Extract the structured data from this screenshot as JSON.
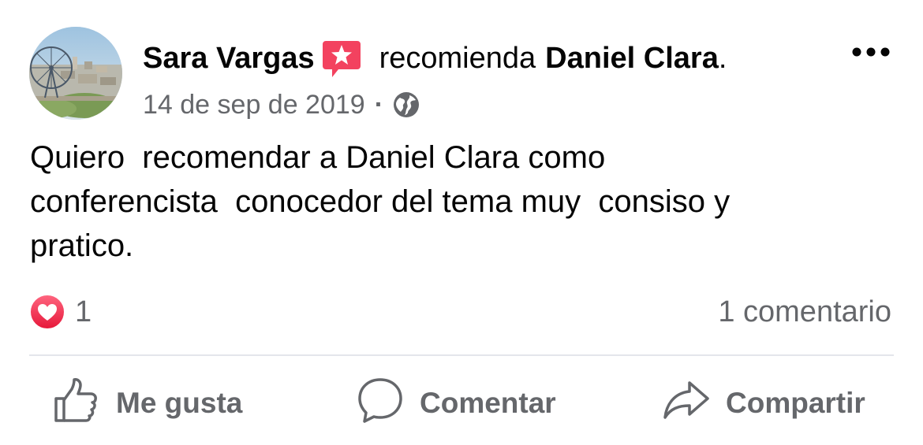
{
  "post": {
    "author": "Sara Vargas",
    "action_verb": "recomienda",
    "recommended": "Daniel Clara",
    "period": ".",
    "date": "14 de sep de 2019",
    "separator": "·",
    "privacy_icon": "globe-icon",
    "badge_icon": "recommendation-star-icon",
    "more_icon": "more-options-icon",
    "text": "Quiero  recomendar a Daniel Clara como\nconferencista  conocedor del tema muy  consiso y\npratico."
  },
  "stats": {
    "reaction_icon": "love-reaction-icon",
    "reaction_count": "1",
    "comments": "1 comentario"
  },
  "actions": {
    "like": "Me gusta",
    "comment": "Comentar",
    "share": "Compartir"
  },
  "colors": {
    "primary_text": "#050505",
    "secondary_text": "#65676b",
    "divider": "#e4e6eb",
    "badge": "#f3425f",
    "love": "#f33e58"
  }
}
